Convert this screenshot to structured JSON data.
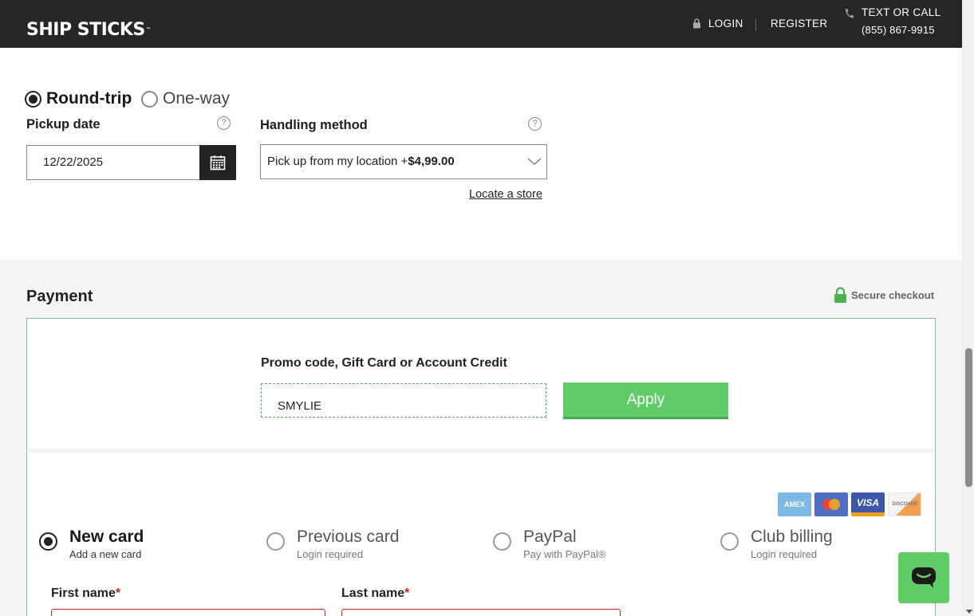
{
  "header": {
    "logo_text": "SHIP STICKS",
    "logo_tm": "™",
    "login_label": "LOGIN",
    "register_label": "REGISTER",
    "contact_label": "TEXT OR CALL",
    "phone": "(855) 867-9915"
  },
  "trip": {
    "round_trip_label": "Round-trip",
    "one_way_label": "One-way",
    "selected": "Round-trip"
  },
  "pickup": {
    "label": "Pickup date",
    "value": "12/22/2025"
  },
  "handling": {
    "label": "Handling method",
    "selected_text": "Pick up from my location +",
    "selected_price": "$4,99.00",
    "locate_link": "Locate a store"
  },
  "payment": {
    "title": "Payment",
    "secure_label": "Secure checkout",
    "promo_label": "Promo code, Gift Card or Account Credit",
    "promo_value": "SMYLIE",
    "apply_label": "Apply",
    "card_logos": [
      "AMEX",
      "MASTERCARD",
      "VISA",
      "DISCOVER"
    ],
    "methods": [
      {
        "title": "New card",
        "subtitle": "Add a new card",
        "selected": true
      },
      {
        "title": "Previous card",
        "subtitle": "Login required",
        "selected": false
      },
      {
        "title": "PayPal",
        "subtitle": "Pay with PayPal®",
        "selected": false
      },
      {
        "title": "Club billing",
        "subtitle": "Login required",
        "selected": false
      }
    ],
    "first_name_label": "First name",
    "last_name_label": "Last name",
    "required_mark": "*"
  },
  "colors": {
    "header_bg": "#262626",
    "accent_green": "#5fcc68",
    "required_red": "#cc2222"
  }
}
